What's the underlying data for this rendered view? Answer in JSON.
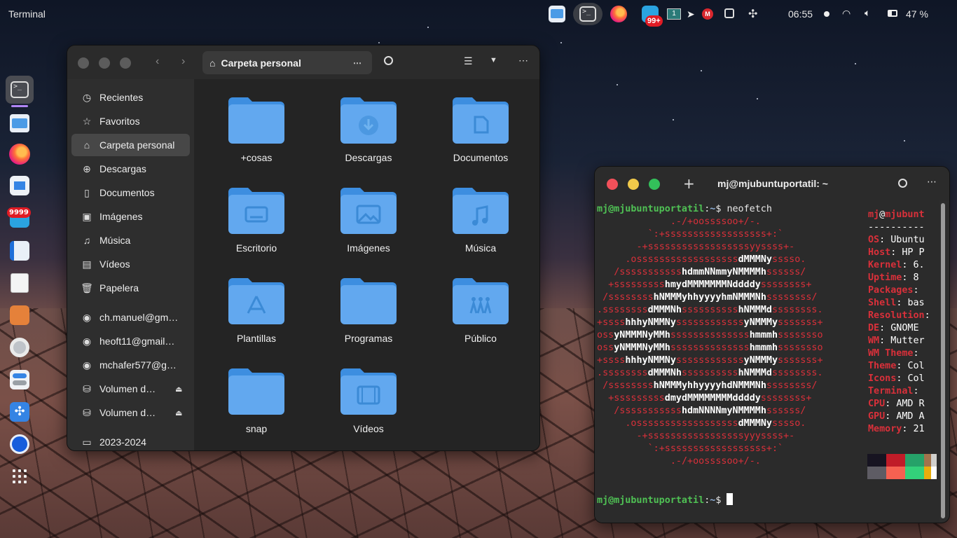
{
  "topbar": {
    "app_title": "Terminal",
    "time": "06:55",
    "battery": "47 %",
    "notification_badge": "99+"
  },
  "dock": {
    "badge": "9999"
  },
  "files": {
    "path": "Carpeta personal",
    "sidebar": [
      {
        "label": "Recientes",
        "icon": "clock-icon"
      },
      {
        "label": "Favoritos",
        "icon": "star-icon"
      },
      {
        "label": "Carpeta personal",
        "icon": "home-icon",
        "active": true
      },
      {
        "label": "Descargas",
        "icon": "download-icon"
      },
      {
        "label": "Documentos",
        "icon": "document-icon"
      },
      {
        "label": "Imágenes",
        "icon": "image-icon"
      },
      {
        "label": "Música",
        "icon": "music-icon"
      },
      {
        "label": "Vídeos",
        "icon": "video-icon"
      },
      {
        "label": "Papelera",
        "icon": "trash-icon"
      },
      {
        "label": "ch.manuel@gm…",
        "icon": "network-icon"
      },
      {
        "label": "heoft11@gmail…",
        "icon": "network-icon"
      },
      {
        "label": "mchafer577@g…",
        "icon": "network-icon"
      },
      {
        "label": "Volumen d…",
        "icon": "drive-icon"
      },
      {
        "label": "Volumen d…",
        "icon": "drive-icon"
      },
      {
        "label": "2023-2024",
        "icon": "folder-icon"
      }
    ],
    "folders": [
      {
        "label": "+cosas",
        "emblem": "none"
      },
      {
        "label": "Descargas",
        "emblem": "download"
      },
      {
        "label": "Documentos",
        "emblem": "document"
      },
      {
        "label": "Escritorio",
        "emblem": "desktop"
      },
      {
        "label": "Imágenes",
        "emblem": "image"
      },
      {
        "label": "Música",
        "emblem": "music"
      },
      {
        "label": "Plantillas",
        "emblem": "template"
      },
      {
        "label": "Programas",
        "emblem": "none"
      },
      {
        "label": "Público",
        "emblem": "people"
      },
      {
        "label": "snap",
        "emblem": "none"
      },
      {
        "label": "Vídeos",
        "emblem": "film"
      }
    ]
  },
  "terminal": {
    "title": "mj@mjubuntuportatil: ~",
    "prompt_user": "mj@mjubuntuportatil",
    "prompt_sep": ":",
    "prompt_dir": "~",
    "prompt_sym": "$ ",
    "command": "neofetch",
    "logo": [
      "             .-/+oossssoo+/-.",
      "         `:+ssssssssssssssssss+:`",
      "       -+ssssssssssssssssssyyssss+-",
      "     .ossssssssssssssssssdMMMNysssso.",
      "   /ssssssssssshdmmNNmmyNMMMMhssssss/",
      "  +ssssssssshmydMMMMMMMNddddyssssssss+",
      " /sssssssshNMMMyhhyyyyhmNMMMNhssssssss/",
      ".ssssssssdMMMNhsssssssssshNMMMdssssssss.",
      "+sssshhhyNMMNyssssssssssssyNMMMysssssss+",
      "ossyNMMMNyMMhsssssssssssssshmmmhssssssso",
      "ossyNMMMNyMMhsssssssssssssshmmmhssssssso",
      "+sssshhhyNMMNyssssssssssssyNMMMysssssss+",
      ".ssssssssdMMMNhsssssssssshNMMMdssssssss.",
      " /sssssssshNMMMyhhyyyyhdNMMMNhssssssss/",
      "  +sssssssssdmydMMMMMMMMddddyssssssss+",
      "   /ssssssssssshdmNNNNmyNMMMMhssssss/",
      "     .ossssssssssssssssssdMMMNysssso.",
      "       -+sssssssssssssssssyyyssss+-",
      "         `:+ssssssssssssssssss+:`",
      "             .-/+oossssoo+/-."
    ],
    "info_user": "mj",
    "info_at": "@",
    "info_host": "mjubunt",
    "info_sep": "----------",
    "info": [
      {
        "key": "OS",
        "value": "Ubuntu"
      },
      {
        "key": "Host",
        "value": "HP P"
      },
      {
        "key": "Kernel",
        "value": "6."
      },
      {
        "key": "Uptime",
        "value": "8"
      },
      {
        "key": "Packages",
        "value": ""
      },
      {
        "key": "Shell",
        "value": "bas"
      },
      {
        "key": "Resolution",
        "value": ""
      },
      {
        "key": "DE",
        "value": "GNOME"
      },
      {
        "key": "WM",
        "value": "Mutter"
      },
      {
        "key": "WM Theme",
        "value": ""
      },
      {
        "key": "Theme",
        "value": "Col"
      },
      {
        "key": "Icons",
        "value": "Col"
      },
      {
        "key": "Terminal",
        "value": ""
      },
      {
        "key": "CPU",
        "value": "AMD R"
      },
      {
        "key": "GPU",
        "value": "AMD A"
      },
      {
        "key": "Memory",
        "value": "21"
      }
    ],
    "palette_top": [
      "#171421",
      "#c01c28",
      "#26a269",
      "#a2734c",
      "#d0cfcc"
    ],
    "palette_bottom": [
      "#5e5c64",
      "#f66151",
      "#33d17a",
      "#e9ad0c",
      "#ffffff"
    ]
  }
}
